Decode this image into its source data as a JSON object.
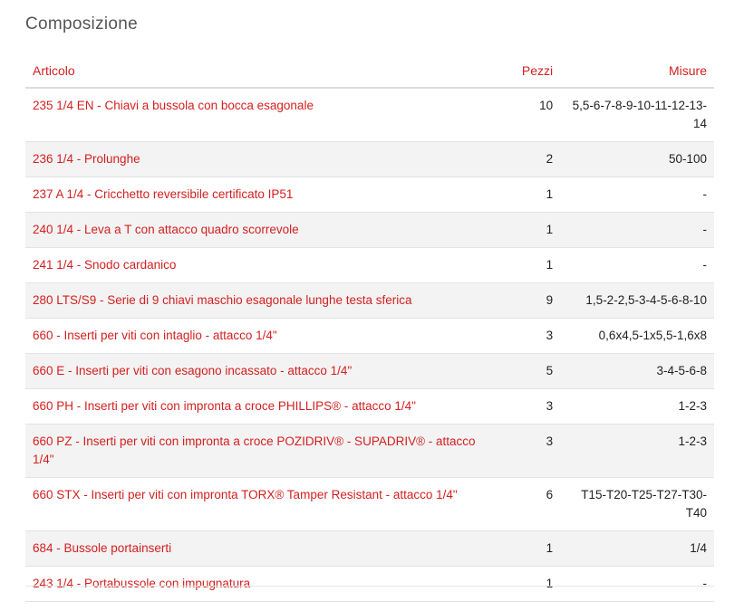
{
  "section": {
    "title": "Composizione"
  },
  "table": {
    "headers": {
      "articolo": "Articolo",
      "pezzi": "Pezzi",
      "misure": "Misure"
    },
    "rows": [
      {
        "articolo": "235 1/4 EN - Chiavi a bussola con bocca esagonale",
        "pezzi": "10",
        "misure": "5,5-6-7-8-9-10-11-12-13-14"
      },
      {
        "articolo": "236 1/4 - Prolunghe",
        "pezzi": "2",
        "misure": "50-100"
      },
      {
        "articolo": "237 A 1/4 - Cricchetto reversibile certificato IP51",
        "pezzi": "1",
        "misure": "-"
      },
      {
        "articolo": "240 1/4 - Leva a T con attacco quadro scorrevole",
        "pezzi": "1",
        "misure": "-"
      },
      {
        "articolo": "241 1/4 - Snodo cardanico",
        "pezzi": "1",
        "misure": "-"
      },
      {
        "articolo": "280 LTS/S9 - Serie di 9 chiavi maschio esagonale lunghe testa sferica",
        "pezzi": "9",
        "misure": "1,5-2-2,5-3-4-5-6-8-10"
      },
      {
        "articolo": "660 - Inserti per viti con intaglio - attacco 1/4\"",
        "pezzi": "3",
        "misure": "0,6x4,5-1x5,5-1,6x8"
      },
      {
        "articolo": "660 E - Inserti per viti con esagono incassato - attacco 1/4\"",
        "pezzi": "5",
        "misure": "3-4-5-6-8"
      },
      {
        "articolo": "660 PH - Inserti per viti con impronta a croce PHILLIPS® - attacco 1/4\"",
        "pezzi": "3",
        "misure": "1-2-3"
      },
      {
        "articolo": "660 PZ - Inserti per viti con impronta a croce POZIDRIV® - SUPADRIV® - attacco 1/4\"",
        "pezzi": "3",
        "misure": "1-2-3"
      },
      {
        "articolo": "660 STX - Inserti per viti con impronta TORX® Tamper Resistant - attacco 1/4\"",
        "pezzi": "6",
        "misure": "T15-T20-T25-T27-T30-T40"
      },
      {
        "articolo": "684 - Bussole portainserti",
        "pezzi": "1",
        "misure": "1/4"
      },
      {
        "articolo": "243 1/4 - Portabussole con impugnatura",
        "pezzi": "1",
        "misure": "-"
      }
    ]
  }
}
